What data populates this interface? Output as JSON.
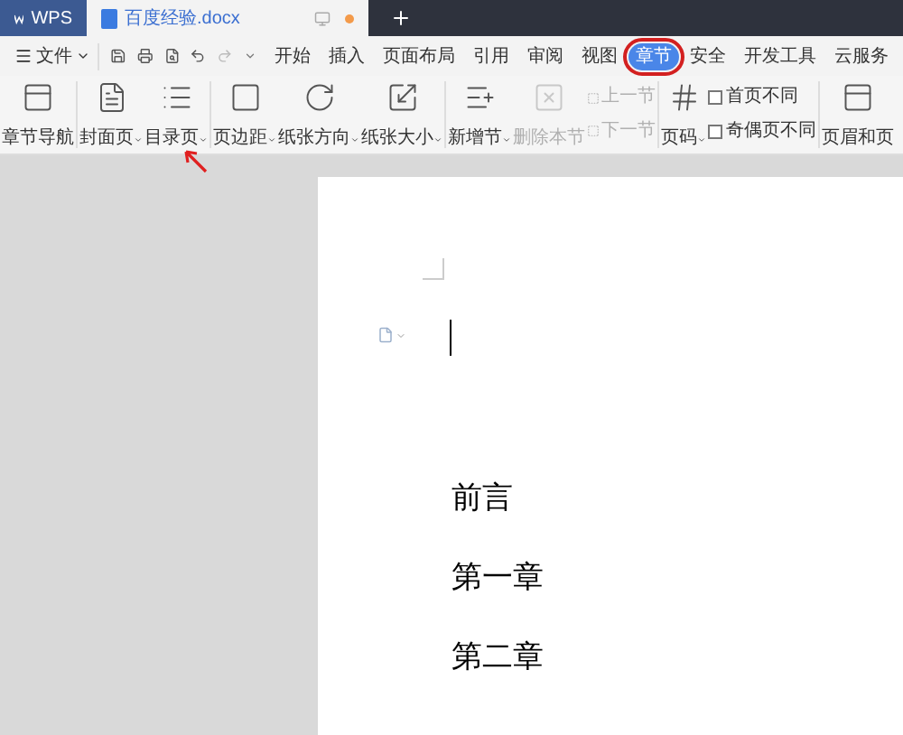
{
  "title_tabs": [
    {
      "label": "WPS",
      "selected": false
    },
    {
      "label": "百度经验.docx",
      "selected": true
    }
  ],
  "menu": {
    "file": "文件",
    "tabs": [
      {
        "label": "开始",
        "selected": false
      },
      {
        "label": "插入",
        "selected": false
      },
      {
        "label": "页面布局",
        "selected": false
      },
      {
        "label": "引用",
        "selected": false
      },
      {
        "label": "审阅",
        "selected": false
      },
      {
        "label": "视图",
        "selected": false
      },
      {
        "label": "章节",
        "selected": true
      },
      {
        "label": "安全",
        "selected": false
      },
      {
        "label": "开发工具",
        "selected": false
      },
      {
        "label": "云服务",
        "selected": false
      }
    ]
  },
  "ribbon": {
    "groups": [
      [
        {
          "kind": "large",
          "label": "章节导航",
          "dropdown": false,
          "disabled": false
        }
      ],
      [
        {
          "kind": "large",
          "label": "封面页",
          "dropdown": true,
          "disabled": false
        },
        {
          "kind": "large",
          "label": "目录页",
          "dropdown": true,
          "disabled": false
        }
      ],
      [
        {
          "kind": "large",
          "label": "页边距",
          "dropdown": true,
          "disabled": false
        },
        {
          "kind": "large",
          "label": "纸张方向",
          "dropdown": true,
          "disabled": false
        },
        {
          "kind": "large",
          "label": "纸张大小",
          "dropdown": true,
          "disabled": false
        }
      ],
      [
        {
          "kind": "large",
          "label": "新增节",
          "dropdown": true,
          "disabled": false
        },
        {
          "kind": "large",
          "label": "删除本节",
          "dropdown": false,
          "disabled": true
        },
        {
          "kind": "stack",
          "rows": [
            {
              "label": "上一节",
              "disabled": true
            },
            {
              "label": "下一节",
              "disabled": true
            }
          ]
        }
      ],
      [
        {
          "kind": "large",
          "label": "页码",
          "dropdown": true,
          "disabled": false
        },
        {
          "kind": "checks",
          "rows": [
            {
              "label": "首页不同",
              "checked": false
            },
            {
              "label": "奇偶页不同",
              "checked": false
            }
          ]
        }
      ],
      [
        {
          "kind": "large",
          "label": "页眉和页",
          "dropdown": false,
          "disabled": false
        }
      ]
    ]
  },
  "document": {
    "lines": [
      "前言",
      "第一章",
      "第二章"
    ]
  }
}
